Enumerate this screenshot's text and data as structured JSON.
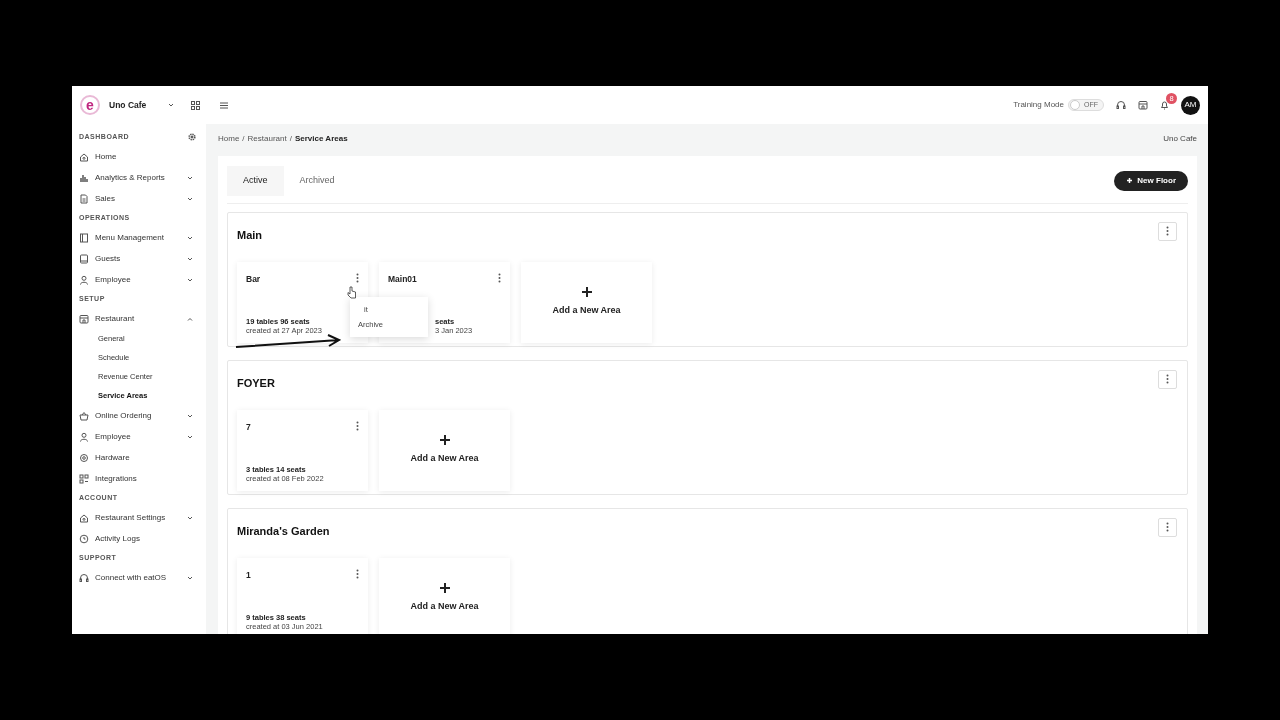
{
  "topbar": {
    "logo_letter": "e",
    "restaurant": "Uno Cafe",
    "training_label": "Training Mode",
    "training_toggle": {
      "on": false,
      "text": "OFF"
    },
    "notification_count": "8",
    "avatar": "AM"
  },
  "sidebar": {
    "sections": [
      {
        "title": "DASHBOARD",
        "settings": true,
        "items": [
          {
            "label": "Home"
          },
          {
            "label": "Analytics & Reports",
            "expanded": false
          },
          {
            "label": "Sales",
            "expanded": false
          }
        ]
      },
      {
        "title": "OPERATIONS",
        "items": [
          {
            "label": "Menu Management",
            "expanded": false
          },
          {
            "label": "Guests",
            "expanded": false
          },
          {
            "label": "Employee",
            "expanded": false
          }
        ]
      },
      {
        "title": "SETUP",
        "items": [
          {
            "label": "Restaurant",
            "expanded": true,
            "children": [
              {
                "label": "General",
                "selected": false
              },
              {
                "label": "Schedule",
                "selected": false
              },
              {
                "label": "Revenue Center",
                "selected": false
              },
              {
                "label": "Service Areas",
                "selected": true
              }
            ]
          },
          {
            "label": "Online Ordering",
            "expanded": false
          },
          {
            "label": "Employee",
            "expanded": false
          },
          {
            "label": "Hardware"
          },
          {
            "label": "Integrations"
          }
        ]
      },
      {
        "title": "ACCOUNT",
        "items": [
          {
            "label": "Restaurant Settings",
            "expanded": false
          },
          {
            "label": "Activity Logs"
          }
        ]
      },
      {
        "title": "SUPPORT",
        "items": [
          {
            "label": "Connect with eatOS",
            "expanded": false
          }
        ]
      }
    ]
  },
  "breadcrumb": {
    "separator": "/",
    "items": [
      "Home",
      "Restaurant",
      "Service Areas"
    ]
  },
  "restaurant_label": "Uno Cafe",
  "tabs": [
    {
      "label": "Active",
      "selected": true
    },
    {
      "label": "Archived",
      "selected": false
    }
  ],
  "new_floor_button": "New Floor",
  "floors": [
    {
      "name": "Main",
      "add_label": "Add a New Area",
      "areas": [
        {
          "name": "Bar",
          "summary": "19 tables 96 seats",
          "created": "created at 27 Apr 2023",
          "menu": {
            "items": [
              "it",
              "Archive"
            ]
          }
        },
        {
          "name": "Main01",
          "summary": "seats",
          "created": "3 Jan 2023",
          "partly_hidden": true
        }
      ]
    },
    {
      "name": "FOYER",
      "add_label": "Add a New Area",
      "areas": [
        {
          "name": "7",
          "summary": "3 tables 14 seats",
          "created": "created at 08 Feb 2022"
        }
      ]
    },
    {
      "name": "Miranda's Garden",
      "add_label": "Add a New Area",
      "areas": [
        {
          "name": "1",
          "summary": "9 tables 38 seats",
          "created": "created at 03 Jun 2021"
        }
      ]
    }
  ]
}
